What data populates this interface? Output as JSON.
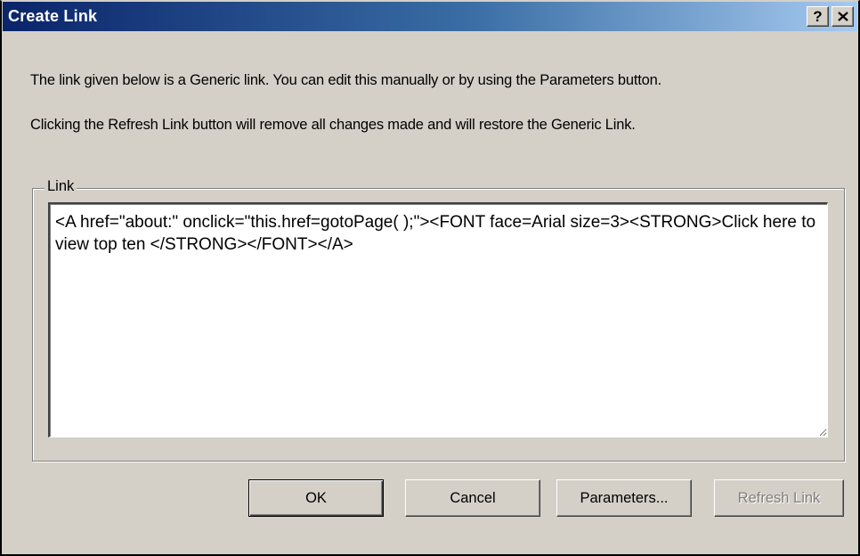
{
  "window": {
    "title": "Create Link",
    "help_label": "?",
    "close_label": "✕"
  },
  "messages": {
    "line1": "The link given below is a Generic link. You can edit this manually or by using the Parameters button.",
    "line2": "Clicking the Refresh Link button will remove all changes made and will restore the Generic Link."
  },
  "link_group": {
    "label": "Link",
    "value": "<A href=\"about:\" onclick=\"this.href=gotoPage( );\"><FONT face=Arial size=3><STRONG>Click here to view top ten </STRONG></FONT></A>"
  },
  "buttons": {
    "ok": "OK",
    "cancel": "Cancel",
    "parameters": "Parameters...",
    "refresh": "Refresh Link"
  },
  "colors": {
    "titlebar_start": "#0a246a",
    "titlebar_end": "#a6caf0",
    "dialog_face": "#d4d0c8",
    "disabled_text": "#808080"
  }
}
